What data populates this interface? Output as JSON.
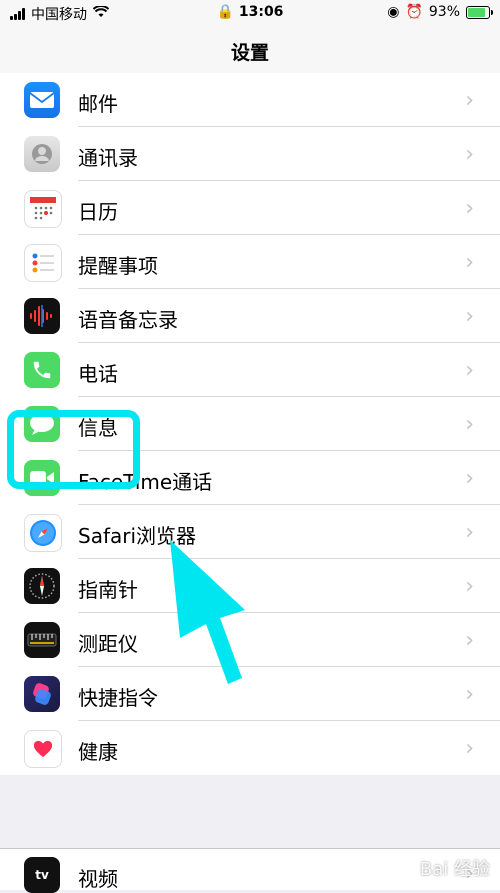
{
  "status_bar": {
    "carrier": "中国移动",
    "time": "13:06",
    "battery": "93%"
  },
  "nav": {
    "title": "设置"
  },
  "rows": [
    {
      "label": "邮件"
    },
    {
      "label": "通讯录"
    },
    {
      "label": "日历"
    },
    {
      "label": "提醒事项"
    },
    {
      "label": "语音备忘录"
    },
    {
      "label": "电话"
    },
    {
      "label": "信息"
    },
    {
      "label": "FaceTime通话"
    },
    {
      "label": "Safari浏览器"
    },
    {
      "label": "指南针"
    },
    {
      "label": "测距仪"
    },
    {
      "label": "快捷指令"
    },
    {
      "label": "健康"
    }
  ],
  "group2": {
    "label": "视频",
    "icon_text": "tv"
  },
  "watermark": "Bai 经验",
  "colors": {
    "highlight": "#00e6f0"
  }
}
